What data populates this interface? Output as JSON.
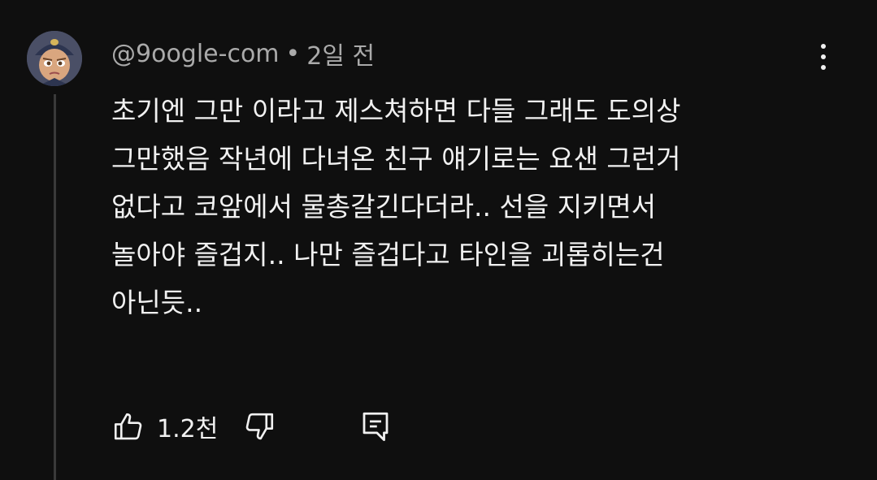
{
  "comment": {
    "author": "@9oogle-com",
    "separator": "•",
    "time_ago": "2일 전",
    "lines": [
      "초기엔 그만 이라고 제스쳐하면 다들 그래도 도의상",
      "그만했음 작년에 다녀온 친구 얘기로는 요샌 그런거",
      "없다고 코앞에서 물총갈긴다더라.. 선을 지키면서",
      "놀아야 즐겁지.. 나만 즐겁다고 타인을 괴롭히는건",
      "아닌듯.."
    ],
    "like_count": "1.2천"
  },
  "icons": {
    "avatar": "avatar-image",
    "menu": "more-vert-icon",
    "like": "thumb-up-icon",
    "dislike": "thumb-down-icon",
    "reply": "comment-reply-icon"
  },
  "colors": {
    "background": "#0f0f0f",
    "primary_text": "#f1f1f1",
    "secondary_text": "#aaaaaa",
    "thread_line": "#3a3a3a"
  }
}
